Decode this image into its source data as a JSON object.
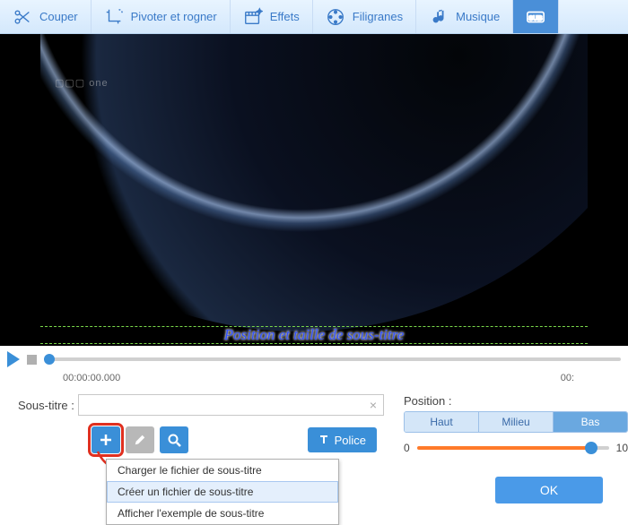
{
  "toolbar": {
    "items": [
      {
        "label": "Couper"
      },
      {
        "label": "Pivoter et rogner"
      },
      {
        "label": "Effets"
      },
      {
        "label": "Filigranes"
      },
      {
        "label": "Musique"
      }
    ]
  },
  "preview": {
    "watermark": "▢▢▢ one",
    "subtitle_overlay": "Position et taille de sous-titre"
  },
  "timeline": {
    "start": "00:00:00.000",
    "end": "00:"
  },
  "subtitle": {
    "label": "Sous-titre :",
    "value": ""
  },
  "buttons": {
    "police": "Police",
    "ok": "OK"
  },
  "dropdown": {
    "items": [
      "Charger le fichier de sous-titre",
      "Créer un fichier de sous-titre",
      "Afficher l'exemple de sous-titre"
    ]
  },
  "position": {
    "label": "Position :",
    "segments": [
      "Haut",
      "Milieu",
      "Bas"
    ],
    "slider_min": "0",
    "slider_max": "10"
  }
}
